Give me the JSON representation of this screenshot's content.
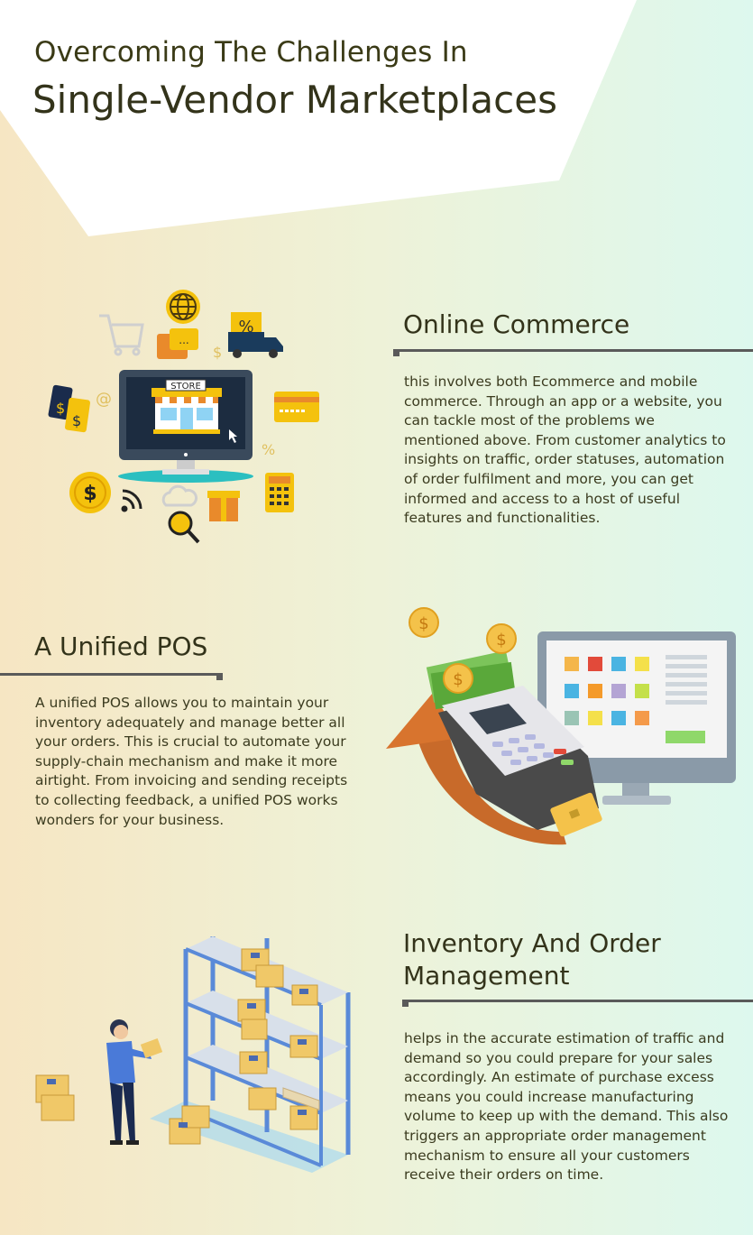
{
  "header": {
    "title_line1": "Overcoming The Challenges In",
    "title_line2": "Single-Vendor Marketplaces"
  },
  "sections": [
    {
      "title": "Online Commerce",
      "text": "this involves both Ecommerce and mobile commerce. Through an app or a website, you can tackle most of the problems we mentioned above. From customer analytics to insights on traffic, order statuses, automation of order fulfilment and more, you can get informed and access to a host of useful features and functionalities.",
      "illustration": {
        "store_sign": "STORE",
        "icons": [
          "shopping-cart-icon",
          "globe-icon",
          "chat-icon",
          "percent-tag-icon",
          "delivery-truck-icon",
          "price-tag-icon",
          "at-sign-icon",
          "credit-card-icon",
          "dollar-coin-icon",
          "wifi-icon",
          "cloud-icon",
          "gift-icon",
          "calculator-icon",
          "magnifier-icon"
        ],
        "symbols": {
          "at": "@",
          "dollar": "$",
          "percent": "%"
        }
      }
    },
    {
      "title": "A Unified POS",
      "text": "A unified POS allows you to maintain your inventory adequately and manage better all your orders. This is crucial to automate your supply-chain mechanism and make it more airtight. From invoicing and sending receipts to collecting feedback, a unified POS works wonders for your business.",
      "illustration": {
        "icons": [
          "dollar-coin-icon",
          "money-stack-icon",
          "pos-terminal-icon",
          "monitor-icon",
          "card-icon",
          "curved-arrow-icon"
        ],
        "symbols": {
          "dollar": "$"
        }
      }
    },
    {
      "title_line1": "Inventory And Order",
      "title_line2": "Management",
      "text": "helps in the accurate estimation of traffic and demand so you could prepare for your sales accordingly. An estimate of purchase excess means you could increase manufacturing volume to keep up with the demand. This also triggers an appropriate order management mechanism to ensure all your customers receive their orders on time.",
      "illustration": {
        "icons": [
          "warehouse-shelf-icon",
          "cardboard-box-icon",
          "worker-icon",
          "pallet-icon"
        ]
      }
    }
  ],
  "colors": {
    "bg_left": "#f6e7c6",
    "bg_right": "#dff8ef",
    "title_text": "#33331a",
    "rule": "#5a5a5a"
  }
}
